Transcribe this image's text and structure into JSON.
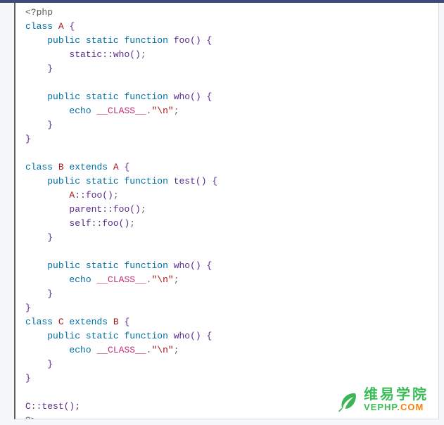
{
  "code": {
    "opentag": "<?php",
    "kw_class": "class",
    "kw_extends": "extends",
    "kw_public": "public",
    "kw_static": "static",
    "kw_function": "function",
    "kw_echo": "echo",
    "cls_A": "A",
    "cls_B": "B",
    "cls_C": "C",
    "fn_foo": "foo",
    "fn_who": "who",
    "fn_test": "test",
    "id_static": "static",
    "id_parent": "parent",
    "id_self": "self",
    "magic_class": "__CLASS__",
    "str_nl": "\"\\n\"",
    "call_C_test": "C::test();",
    "closetag": "?>"
  },
  "watermark": {
    "title_cn": "维易学院",
    "url_part1": "VEPHP",
    "url_dot": ".",
    "url_part2": "COM"
  }
}
